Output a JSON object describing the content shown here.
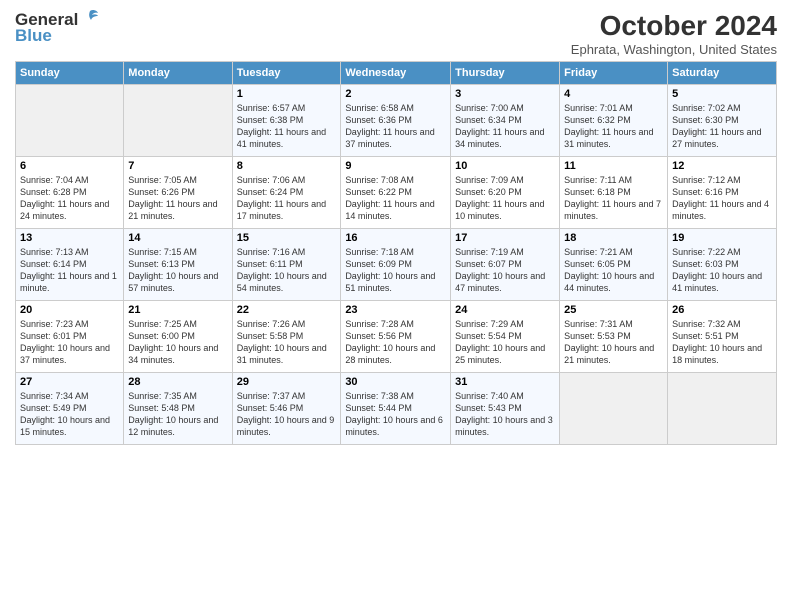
{
  "header": {
    "logo_line1": "General",
    "logo_line2": "Blue",
    "title": "October 2024",
    "subtitle": "Ephrata, Washington, United States"
  },
  "weekdays": [
    "Sunday",
    "Monday",
    "Tuesday",
    "Wednesday",
    "Thursday",
    "Friday",
    "Saturday"
  ],
  "weeks": [
    [
      {
        "day": "",
        "sunrise": "",
        "sunset": "",
        "daylight": ""
      },
      {
        "day": "",
        "sunrise": "",
        "sunset": "",
        "daylight": ""
      },
      {
        "day": "1",
        "sunrise": "Sunrise: 6:57 AM",
        "sunset": "Sunset: 6:38 PM",
        "daylight": "Daylight: 11 hours and 41 minutes."
      },
      {
        "day": "2",
        "sunrise": "Sunrise: 6:58 AM",
        "sunset": "Sunset: 6:36 PM",
        "daylight": "Daylight: 11 hours and 37 minutes."
      },
      {
        "day": "3",
        "sunrise": "Sunrise: 7:00 AM",
        "sunset": "Sunset: 6:34 PM",
        "daylight": "Daylight: 11 hours and 34 minutes."
      },
      {
        "day": "4",
        "sunrise": "Sunrise: 7:01 AM",
        "sunset": "Sunset: 6:32 PM",
        "daylight": "Daylight: 11 hours and 31 minutes."
      },
      {
        "day": "5",
        "sunrise": "Sunrise: 7:02 AM",
        "sunset": "Sunset: 6:30 PM",
        "daylight": "Daylight: 11 hours and 27 minutes."
      }
    ],
    [
      {
        "day": "6",
        "sunrise": "Sunrise: 7:04 AM",
        "sunset": "Sunset: 6:28 PM",
        "daylight": "Daylight: 11 hours and 24 minutes."
      },
      {
        "day": "7",
        "sunrise": "Sunrise: 7:05 AM",
        "sunset": "Sunset: 6:26 PM",
        "daylight": "Daylight: 11 hours and 21 minutes."
      },
      {
        "day": "8",
        "sunrise": "Sunrise: 7:06 AM",
        "sunset": "Sunset: 6:24 PM",
        "daylight": "Daylight: 11 hours and 17 minutes."
      },
      {
        "day": "9",
        "sunrise": "Sunrise: 7:08 AM",
        "sunset": "Sunset: 6:22 PM",
        "daylight": "Daylight: 11 hours and 14 minutes."
      },
      {
        "day": "10",
        "sunrise": "Sunrise: 7:09 AM",
        "sunset": "Sunset: 6:20 PM",
        "daylight": "Daylight: 11 hours and 10 minutes."
      },
      {
        "day": "11",
        "sunrise": "Sunrise: 7:11 AM",
        "sunset": "Sunset: 6:18 PM",
        "daylight": "Daylight: 11 hours and 7 minutes."
      },
      {
        "day": "12",
        "sunrise": "Sunrise: 7:12 AM",
        "sunset": "Sunset: 6:16 PM",
        "daylight": "Daylight: 11 hours and 4 minutes."
      }
    ],
    [
      {
        "day": "13",
        "sunrise": "Sunrise: 7:13 AM",
        "sunset": "Sunset: 6:14 PM",
        "daylight": "Daylight: 11 hours and 1 minute."
      },
      {
        "day": "14",
        "sunrise": "Sunrise: 7:15 AM",
        "sunset": "Sunset: 6:13 PM",
        "daylight": "Daylight: 10 hours and 57 minutes."
      },
      {
        "day": "15",
        "sunrise": "Sunrise: 7:16 AM",
        "sunset": "Sunset: 6:11 PM",
        "daylight": "Daylight: 10 hours and 54 minutes."
      },
      {
        "day": "16",
        "sunrise": "Sunrise: 7:18 AM",
        "sunset": "Sunset: 6:09 PM",
        "daylight": "Daylight: 10 hours and 51 minutes."
      },
      {
        "day": "17",
        "sunrise": "Sunrise: 7:19 AM",
        "sunset": "Sunset: 6:07 PM",
        "daylight": "Daylight: 10 hours and 47 minutes."
      },
      {
        "day": "18",
        "sunrise": "Sunrise: 7:21 AM",
        "sunset": "Sunset: 6:05 PM",
        "daylight": "Daylight: 10 hours and 44 minutes."
      },
      {
        "day": "19",
        "sunrise": "Sunrise: 7:22 AM",
        "sunset": "Sunset: 6:03 PM",
        "daylight": "Daylight: 10 hours and 41 minutes."
      }
    ],
    [
      {
        "day": "20",
        "sunrise": "Sunrise: 7:23 AM",
        "sunset": "Sunset: 6:01 PM",
        "daylight": "Daylight: 10 hours and 37 minutes."
      },
      {
        "day": "21",
        "sunrise": "Sunrise: 7:25 AM",
        "sunset": "Sunset: 6:00 PM",
        "daylight": "Daylight: 10 hours and 34 minutes."
      },
      {
        "day": "22",
        "sunrise": "Sunrise: 7:26 AM",
        "sunset": "Sunset: 5:58 PM",
        "daylight": "Daylight: 10 hours and 31 minutes."
      },
      {
        "day": "23",
        "sunrise": "Sunrise: 7:28 AM",
        "sunset": "Sunset: 5:56 PM",
        "daylight": "Daylight: 10 hours and 28 minutes."
      },
      {
        "day": "24",
        "sunrise": "Sunrise: 7:29 AM",
        "sunset": "Sunset: 5:54 PM",
        "daylight": "Daylight: 10 hours and 25 minutes."
      },
      {
        "day": "25",
        "sunrise": "Sunrise: 7:31 AM",
        "sunset": "Sunset: 5:53 PM",
        "daylight": "Daylight: 10 hours and 21 minutes."
      },
      {
        "day": "26",
        "sunrise": "Sunrise: 7:32 AM",
        "sunset": "Sunset: 5:51 PM",
        "daylight": "Daylight: 10 hours and 18 minutes."
      }
    ],
    [
      {
        "day": "27",
        "sunrise": "Sunrise: 7:34 AM",
        "sunset": "Sunset: 5:49 PM",
        "daylight": "Daylight: 10 hours and 15 minutes."
      },
      {
        "day": "28",
        "sunrise": "Sunrise: 7:35 AM",
        "sunset": "Sunset: 5:48 PM",
        "daylight": "Daylight: 10 hours and 12 minutes."
      },
      {
        "day": "29",
        "sunrise": "Sunrise: 7:37 AM",
        "sunset": "Sunset: 5:46 PM",
        "daylight": "Daylight: 10 hours and 9 minutes."
      },
      {
        "day": "30",
        "sunrise": "Sunrise: 7:38 AM",
        "sunset": "Sunset: 5:44 PM",
        "daylight": "Daylight: 10 hours and 6 minutes."
      },
      {
        "day": "31",
        "sunrise": "Sunrise: 7:40 AM",
        "sunset": "Sunset: 5:43 PM",
        "daylight": "Daylight: 10 hours and 3 minutes."
      },
      {
        "day": "",
        "sunrise": "",
        "sunset": "",
        "daylight": ""
      },
      {
        "day": "",
        "sunrise": "",
        "sunset": "",
        "daylight": ""
      }
    ]
  ]
}
